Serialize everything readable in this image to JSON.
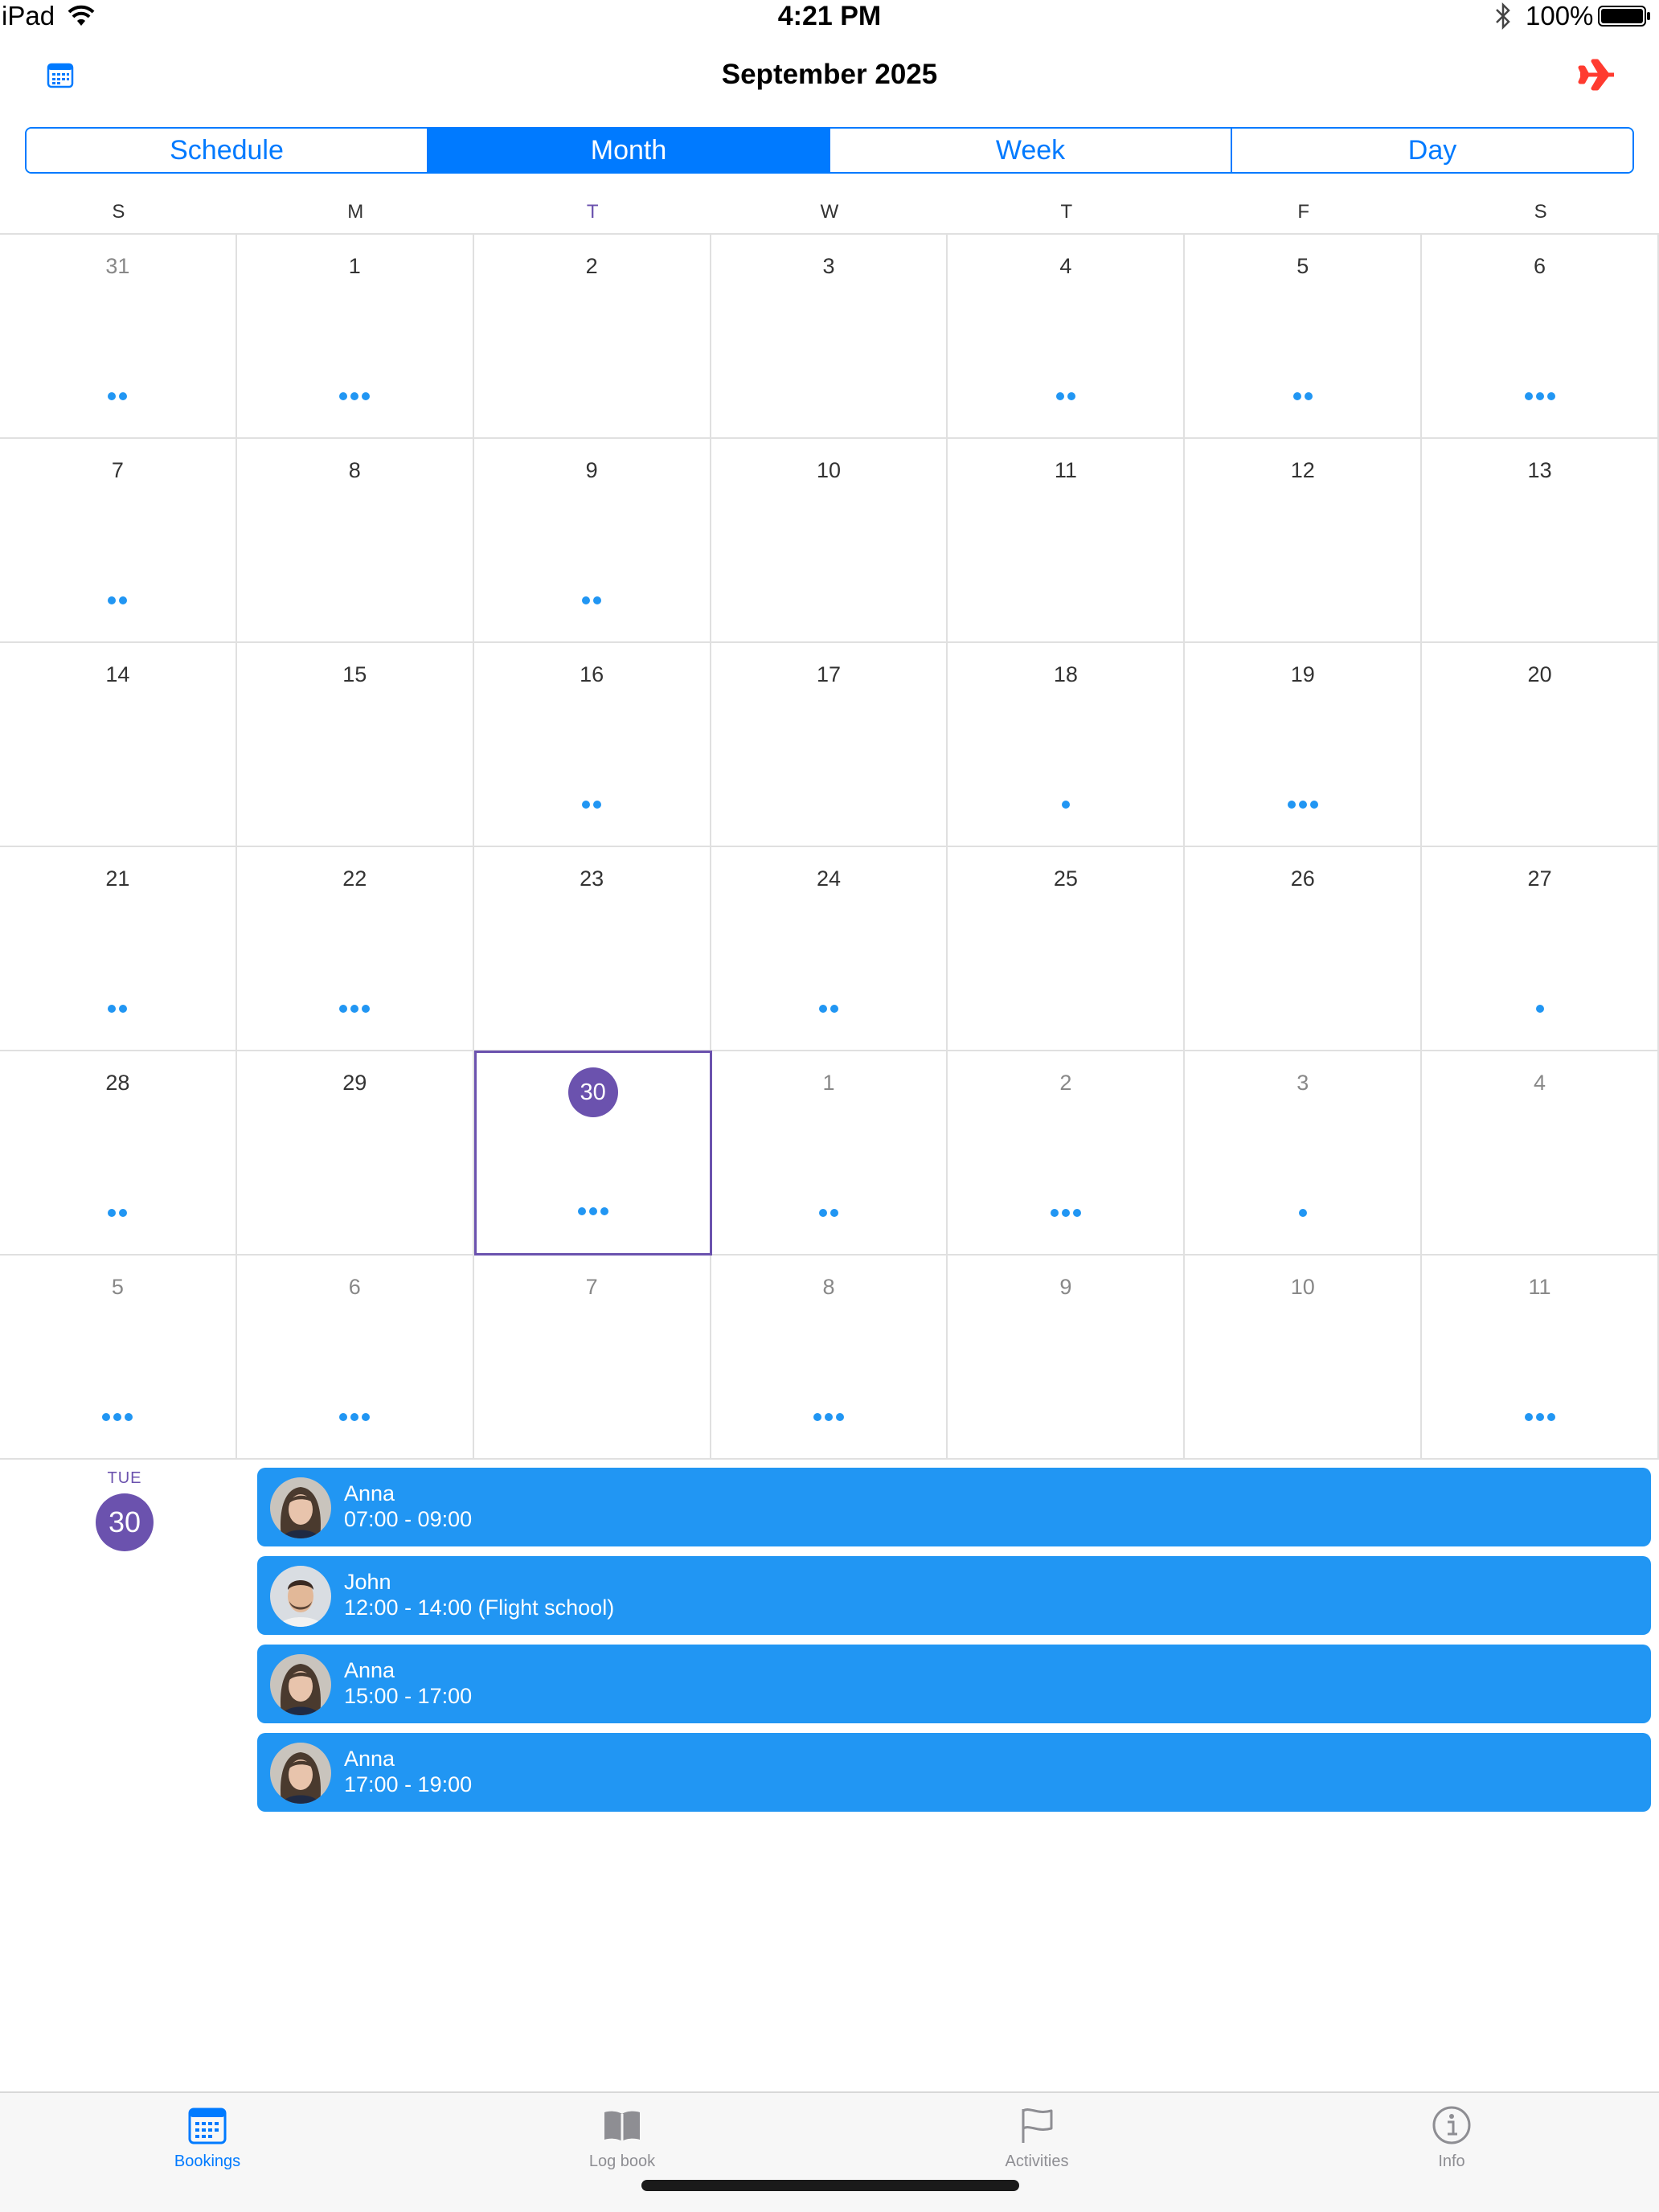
{
  "status_bar": {
    "device": "iPad",
    "time": "4:21 PM",
    "battery": "100%"
  },
  "nav": {
    "title": "September 2025",
    "left_icon": "calendar-icon",
    "right_icon": "airplane-icon"
  },
  "segmented": {
    "tabs": [
      "Schedule",
      "Month",
      "Week",
      "Day"
    ],
    "active": 1
  },
  "weekdays": [
    "S",
    "M",
    "T",
    "W",
    "T",
    "F",
    "S"
  ],
  "today_weekday_index": 2,
  "calendar": {
    "weeks": [
      [
        {
          "d": "31",
          "o": true,
          "n": 2
        },
        {
          "d": "1",
          "n": 3
        },
        {
          "d": "2",
          "n": 0
        },
        {
          "d": "3",
          "n": 0
        },
        {
          "d": "4",
          "n": 2
        },
        {
          "d": "5",
          "n": 2
        },
        {
          "d": "6",
          "n": 3
        }
      ],
      [
        {
          "d": "7",
          "n": 2
        },
        {
          "d": "8",
          "n": 0
        },
        {
          "d": "9",
          "n": 2
        },
        {
          "d": "10",
          "n": 0
        },
        {
          "d": "11",
          "n": 0
        },
        {
          "d": "12",
          "n": 0
        },
        {
          "d": "13",
          "n": 0
        }
      ],
      [
        {
          "d": "14",
          "n": 0
        },
        {
          "d": "15",
          "n": 0
        },
        {
          "d": "16",
          "n": 2
        },
        {
          "d": "17",
          "n": 0
        },
        {
          "d": "18",
          "n": 1
        },
        {
          "d": "19",
          "n": 3
        },
        {
          "d": "20",
          "n": 0
        }
      ],
      [
        {
          "d": "21",
          "n": 2
        },
        {
          "d": "22",
          "n": 3
        },
        {
          "d": "23",
          "n": 0
        },
        {
          "d": "24",
          "n": 2
        },
        {
          "d": "25",
          "n": 0
        },
        {
          "d": "26",
          "n": 0
        },
        {
          "d": "27",
          "n": 1
        }
      ],
      [
        {
          "d": "28",
          "n": 2
        },
        {
          "d": "29",
          "n": 0
        },
        {
          "d": "30",
          "n": 3,
          "sel": true
        },
        {
          "d": "1",
          "o": true,
          "n": 2
        },
        {
          "d": "2",
          "o": true,
          "n": 3
        },
        {
          "d": "3",
          "o": true,
          "n": 1
        },
        {
          "d": "4",
          "o": true,
          "n": 0
        }
      ],
      [
        {
          "d": "5",
          "o": true,
          "n": 3
        },
        {
          "d": "6",
          "o": true,
          "n": 3
        },
        {
          "d": "7",
          "o": true,
          "n": 0
        },
        {
          "d": "8",
          "o": true,
          "n": 3
        },
        {
          "d": "9",
          "o": true,
          "n": 0
        },
        {
          "d": "10",
          "o": true,
          "n": 0
        },
        {
          "d": "11",
          "o": true,
          "n": 3
        }
      ]
    ],
    "dot_color": "#2196f3",
    "selected_color": "#6b52ae"
  },
  "agenda": {
    "dow": "TUE",
    "date": "30",
    "bookings": [
      {
        "name": "Anna",
        "time": "07:00 - 09:00",
        "avatar": "female"
      },
      {
        "name": "John",
        "time": "12:00 - 14:00 (Flight school)",
        "avatar": "male"
      },
      {
        "name": "Anna",
        "time": "15:00 - 17:00",
        "avatar": "female"
      },
      {
        "name": "Anna",
        "time": "17:00 - 19:00",
        "avatar": "female"
      }
    ],
    "booking_color": "#2196f3"
  },
  "tabbar": {
    "items": [
      {
        "label": "Bookings",
        "icon": "calendar-grid-icon",
        "active": true
      },
      {
        "label": "Log book",
        "icon": "book-icon",
        "active": false
      },
      {
        "label": "Activities",
        "icon": "flag-icon",
        "active": false
      },
      {
        "label": "Info",
        "icon": "info-icon",
        "active": false
      }
    ]
  }
}
